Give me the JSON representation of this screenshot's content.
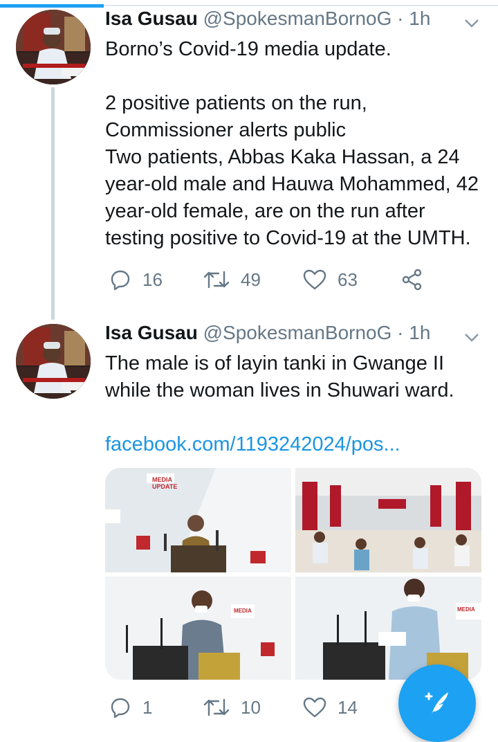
{
  "tweets": [
    {
      "name": "Isa Gusau",
      "handle": "@SpokesmanBornoG",
      "time": "1h",
      "separator": " · ",
      "paragraphs": [
        "Borno’s Covid-19 media update.",
        "",
        "2 positive patients on the run, Commissioner alerts public",
        "Two patients, Abbas Kaka Hassan, a 24 year-old male and Hauwa Mohammed, 42 year-old female, are on the run after testing positive to Covid-19 at the UMTH."
      ],
      "replies": "16",
      "retweets": "49",
      "likes": "63"
    },
    {
      "name": "Isa Gusau",
      "handle": "@SpokesmanBornoG",
      "time": "1h",
      "separator": " · ",
      "text": "The male is of layin tanki in Gwange II while the woman lives in Shuwari ward.",
      "link": "facebook.com/1193242024/pos...",
      "replies": "1",
      "retweets": "10",
      "likes": "14",
      "media_labels": {
        "media_update": "MEDIA UPDATE"
      }
    }
  ],
  "colors": {
    "brand": "#1da1f2",
    "link": "#1b95e0",
    "muted": "#657786"
  },
  "icons": {
    "reply": "reply-icon",
    "retweet": "retweet-icon",
    "like": "heart-icon",
    "share": "share-icon",
    "compose": "compose-tweet-icon"
  }
}
